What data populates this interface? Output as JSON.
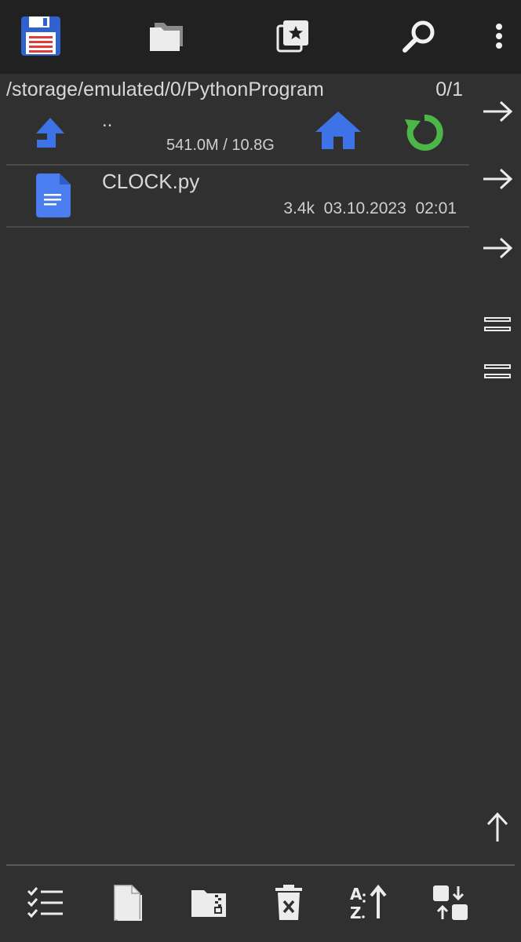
{
  "toolbar": {
    "icons": [
      "save-icon",
      "folders-icon",
      "bookmarks-icon",
      "search-icon",
      "more-vertical-icon"
    ]
  },
  "path": {
    "current": "/storage/emulated/0/PythonProgram",
    "selection_count": "0/1"
  },
  "parent_entry": {
    "name": "..",
    "storage_usage": "541.0M / 10.8G"
  },
  "files": [
    {
      "name": "CLOCK.py",
      "meta": "3.4k  03.10.2023  02:01",
      "icon": "document-icon"
    }
  ],
  "side_actions": [
    "arrow-right-icon",
    "arrow-right-icon",
    "arrow-right-icon",
    "equals-icon",
    "equals-icon",
    "arrow-up-icon"
  ],
  "bottom_toolbar": {
    "icons": [
      "checklist-icon",
      "new-file-icon",
      "zip-folder-icon",
      "delete-icon",
      "sort-az-icon",
      "swap-panels-icon"
    ]
  },
  "colors": {
    "background": "#303030",
    "toolbar": "#212121",
    "blue": "#3d73e6",
    "green": "#4cb648",
    "text": "#d8d8d8"
  }
}
